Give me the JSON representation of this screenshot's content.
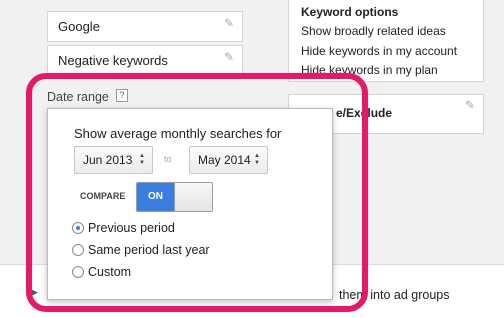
{
  "left_rows": [
    {
      "label": "Google"
    },
    {
      "label": "Negative keywords"
    }
  ],
  "keyword_options": {
    "title": "Keyword options",
    "items": [
      "Show broadly related ideas",
      "Hide keywords in my account",
      "Hide keywords in my plan"
    ]
  },
  "include_exclude": {
    "label": "e/Exclude"
  },
  "date_range": {
    "label": "Date range",
    "help": "?",
    "popup": {
      "title": "Show average monthly searches for",
      "from": "Jun 2013",
      "to_label": "to",
      "to": "May 2014",
      "compare_label": "COMPARE",
      "toggle_state": "ON",
      "options": [
        {
          "label": "Previous period",
          "checked": true
        },
        {
          "label": "Same period last year",
          "checked": false
        },
        {
          "label": "Custom",
          "checked": false
        }
      ]
    }
  },
  "bottom_text": "them into ad groups",
  "icons": {
    "edit": "pencil-icon",
    "stepper": "up-down-arrow-icon",
    "expand": "triangle-right-icon"
  },
  "colors": {
    "highlight": "#e5196a",
    "toggle_on": "#3a7ee0",
    "radio_dot": "#3a7ee0"
  }
}
